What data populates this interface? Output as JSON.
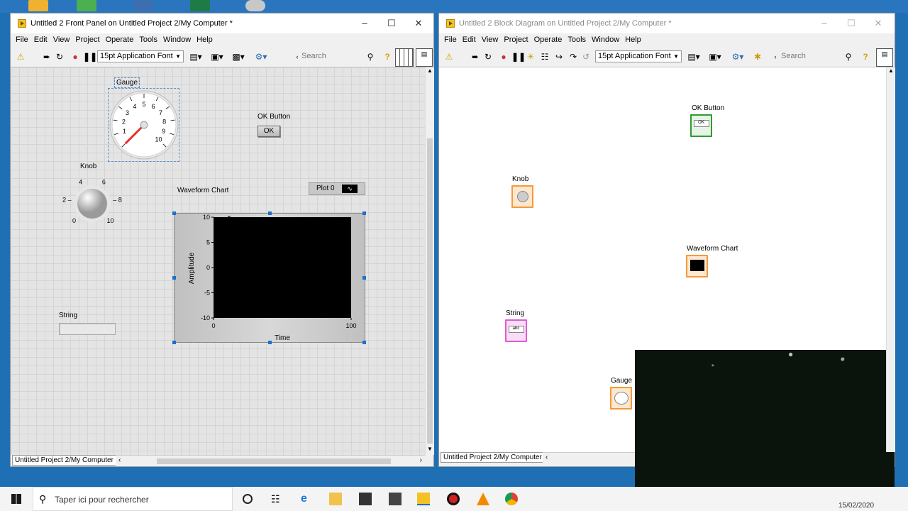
{
  "colors": {
    "desktop": "#1f6fb5",
    "chart_plot": "#000000",
    "gauge_needle": "#e8312b",
    "knob_terminal": "#f39a3a",
    "ok_terminal": "#2f9c2f",
    "string_terminal": "#e05bd3"
  },
  "front_panel": {
    "title": "Untitled 2 Front Panel on Untitled Project 2/My Computer *",
    "menu": [
      "File",
      "Edit",
      "View",
      "Project",
      "Operate",
      "Tools",
      "Window",
      "Help"
    ],
    "font": "15pt Application Font",
    "search_placeholder": "Search",
    "gauge": {
      "label": "Gauge",
      "ticks": [
        "1",
        "2",
        "3",
        "4",
        "5",
        "6",
        "7",
        "8",
        "9",
        "10"
      ],
      "zero": "0",
      "value": 0
    },
    "ok_button": {
      "label": "OK Button",
      "text": "OK"
    },
    "knob": {
      "label": "Knob",
      "ticks": [
        "0",
        "2",
        "4",
        "6",
        "8",
        "10"
      ]
    },
    "waveform_chart": {
      "label": "Waveform Chart",
      "plot_legend": "Plot 0",
      "ylabel": "Amplitude",
      "xlabel": "Time",
      "yticks": [
        "10",
        "5",
        "0",
        "-5",
        "-10"
      ],
      "xticks": [
        "0",
        "100"
      ]
    },
    "string": {
      "label": "String",
      "value": ""
    },
    "status": "Untitled Project 2/My Computer"
  },
  "chart_data": {
    "type": "line",
    "title": "Waveform Chart",
    "xlabel": "Time",
    "ylabel": "Amplitude",
    "xlim": [
      0,
      100
    ],
    "ylim": [
      -10,
      10
    ],
    "series": [
      {
        "name": "Plot 0",
        "values": []
      }
    ]
  },
  "block_diagram": {
    "title": "Untitled 2 Block Diagram on Untitled Project 2/My Computer *",
    "menu": [
      "File",
      "Edit",
      "View",
      "Project",
      "Operate",
      "Tools",
      "Window",
      "Help"
    ],
    "font": "15pt Application Font",
    "search_placeholder": "Search",
    "terminals": {
      "ok": "OK Button",
      "knob": "Knob",
      "waveform": "Waveform Chart",
      "string": "String",
      "gauge": "Gauge"
    },
    "status": "Untitled Project 2/My Computer"
  },
  "taskbar": {
    "search_placeholder": "Taper ici pour rechercher",
    "date": "15/02/2020"
  }
}
